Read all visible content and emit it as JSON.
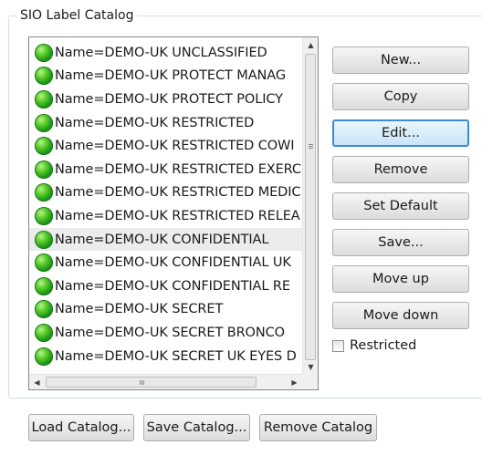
{
  "group": {
    "title": "SIO Label Catalog"
  },
  "labels": [
    {
      "text": "Name=DEMO-UK UNCLASSIFIED",
      "selected": false
    },
    {
      "text": "Name=DEMO-UK PROTECT MANAG",
      "selected": false
    },
    {
      "text": "Name=DEMO-UK PROTECT POLICY",
      "selected": false
    },
    {
      "text": "Name=DEMO-UK RESTRICTED",
      "selected": false
    },
    {
      "text": "Name=DEMO-UK RESTRICTED COWI",
      "selected": false
    },
    {
      "text": "Name=DEMO-UK RESTRICTED EXERC",
      "selected": false
    },
    {
      "text": "Name=DEMO-UK RESTRICTED MEDIC",
      "selected": false
    },
    {
      "text": "Name=DEMO-UK RESTRICTED RELEA",
      "selected": false
    },
    {
      "text": "Name=DEMO-UK CONFIDENTIAL",
      "selected": true
    },
    {
      "text": "Name=DEMO-UK CONFIDENTIAL UK",
      "selected": false
    },
    {
      "text": "Name=DEMO-UK CONFIDENTIAL RE",
      "selected": false
    },
    {
      "text": "Name=DEMO-UK SECRET",
      "selected": false
    },
    {
      "text": "Name=DEMO-UK SECRET BRONCO",
      "selected": false
    },
    {
      "text": "Name=DEMO-UK SECRET UK EYES D",
      "selected": false
    }
  ],
  "buttons": {
    "new": "New...",
    "copy": "Copy",
    "edit": "Edit...",
    "remove": "Remove",
    "set_default": "Set Default",
    "save": "Save...",
    "move_up": "Move up",
    "move_down": "Move down"
  },
  "restricted": {
    "label": "Restricted",
    "checked": false
  },
  "bottom_buttons": {
    "load": "Load Catalog...",
    "save": "Save Catalog...",
    "remove": "Remove Catalog"
  },
  "colors": {
    "focus_border": "#3c8bd6",
    "bullet": "#2fa82a"
  },
  "icons": {
    "label_status": "green-circle-icon"
  }
}
